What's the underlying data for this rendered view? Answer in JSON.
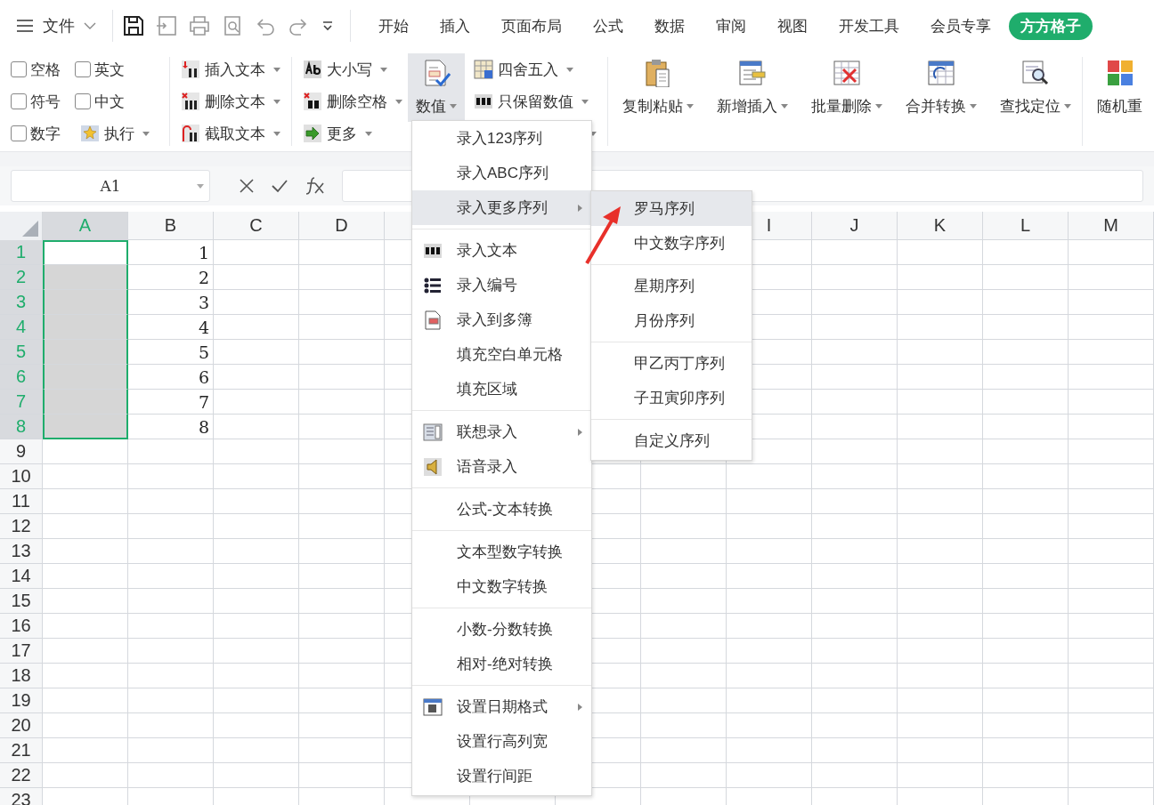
{
  "menu_bar": {
    "file_label": "文件"
  },
  "tabs": [
    {
      "label": "开始",
      "selected": false
    },
    {
      "label": "插入",
      "selected": false
    },
    {
      "label": "页面布局",
      "selected": false
    },
    {
      "label": "公式",
      "selected": false
    },
    {
      "label": "数据",
      "selected": false
    },
    {
      "label": "审阅",
      "selected": false
    },
    {
      "label": "视图",
      "selected": false
    },
    {
      "label": "开发工具",
      "selected": false
    },
    {
      "label": "会员专享",
      "selected": false
    },
    {
      "label": "方方格子",
      "selected": true
    }
  ],
  "ribbon": {
    "checkboxes": [
      {
        "label": "空格",
        "checked": false
      },
      {
        "label": "英文",
        "checked": false
      },
      {
        "label": "符号",
        "checked": false
      },
      {
        "label": "中文",
        "checked": false
      },
      {
        "label": "数字",
        "checked": false
      }
    ],
    "run_button": {
      "label": "执行"
    },
    "text_tools": [
      {
        "label": "插入文本"
      },
      {
        "label": "删除文本"
      },
      {
        "label": "截取文本"
      }
    ],
    "case_tools": [
      {
        "label": "大小写"
      },
      {
        "label": "删除空格"
      },
      {
        "label": "更多"
      }
    ],
    "value_button": {
      "label": "数值",
      "selected": true
    },
    "number_tools": [
      {
        "label": "四舍五入"
      },
      {
        "label": "只保留数值"
      }
    ],
    "big_buttons": [
      {
        "label": "复制粘贴"
      },
      {
        "label": "新增插入"
      },
      {
        "label": "批量删除"
      },
      {
        "label": "合并转换"
      },
      {
        "label": "查找定位"
      }
    ],
    "last_button": {
      "label": "随机重"
    }
  },
  "formula_bar": {
    "name_box": "A1"
  },
  "columns": [
    {
      "label": "A",
      "selected": true
    },
    {
      "label": "B",
      "selected": false
    },
    {
      "label": "C",
      "selected": false
    },
    {
      "label": "D",
      "selected": false
    },
    {
      "label": "I",
      "selected": false
    },
    {
      "label": "J",
      "selected": false
    },
    {
      "label": "K",
      "selected": false
    },
    {
      "label": "L",
      "selected": false
    },
    {
      "label": "M",
      "selected": false
    }
  ],
  "rows": [
    {
      "label": "1",
      "selected": true,
      "active": true,
      "cells": {
        "B": "1"
      }
    },
    {
      "label": "2",
      "selected": true,
      "active": false,
      "cells": {
        "B": "2"
      }
    },
    {
      "label": "3",
      "selected": true,
      "active": false,
      "cells": {
        "B": "3"
      }
    },
    {
      "label": "4",
      "selected": true,
      "active": false,
      "cells": {
        "B": "4"
      }
    },
    {
      "label": "5",
      "selected": true,
      "active": false,
      "cells": {
        "B": "5"
      }
    },
    {
      "label": "6",
      "selected": true,
      "active": false,
      "cells": {
        "B": "6"
      }
    },
    {
      "label": "7",
      "selected": true,
      "active": false,
      "cells": {
        "B": "7"
      }
    },
    {
      "label": "8",
      "selected": true,
      "active": false,
      "cells": {
        "B": "8"
      }
    },
    {
      "label": "9",
      "selected": false,
      "active": false
    },
    {
      "label": "10",
      "selected": false,
      "active": false
    },
    {
      "label": "11",
      "selected": false,
      "active": false
    },
    {
      "label": "12",
      "selected": false,
      "active": false
    },
    {
      "label": "13",
      "selected": false,
      "active": false
    },
    {
      "label": "14",
      "selected": false,
      "active": false
    },
    {
      "label": "15",
      "selected": false,
      "active": false
    },
    {
      "label": "16",
      "selected": false,
      "active": false
    },
    {
      "label": "17",
      "selected": false,
      "active": false
    },
    {
      "label": "18",
      "selected": false,
      "active": false
    },
    {
      "label": "19",
      "selected": false,
      "active": false
    },
    {
      "label": "20",
      "selected": false,
      "active": false
    },
    {
      "label": "21",
      "selected": false,
      "active": false
    },
    {
      "label": "22",
      "selected": false,
      "active": false
    },
    {
      "label": "23",
      "selected": false,
      "active": false
    }
  ],
  "dropdown_menu": {
    "groups": [
      {
        "items": [
          {
            "label": "录入123序列",
            "selected": false,
            "submenu": false
          },
          {
            "label": "录入ABC序列",
            "selected": false,
            "submenu": false
          },
          {
            "label": "录入更多序列",
            "selected": true,
            "submenu": true
          }
        ]
      },
      {
        "items": [
          {
            "label": "录入文本",
            "selected": false,
            "submenu": false,
            "kind": "abc"
          },
          {
            "label": "录入编号",
            "selected": false,
            "submenu": false,
            "kind": "list"
          },
          {
            "label": "录入到多簿",
            "selected": false,
            "submenu": false,
            "kind": "doc"
          },
          {
            "label": "填充空白单元格",
            "selected": false,
            "submenu": false
          },
          {
            "label": "填充区域",
            "selected": false,
            "submenu": false
          }
        ]
      },
      {
        "items": [
          {
            "label": "联想录入",
            "selected": false,
            "submenu": true,
            "kind": "panel"
          },
          {
            "label": "语音录入",
            "selected": false,
            "submenu": false,
            "kind": "speaker"
          }
        ]
      },
      {
        "items": [
          {
            "label": "公式-文本转换",
            "selected": false,
            "submenu": false
          }
        ]
      },
      {
        "items": [
          {
            "label": "文本型数字转换",
            "selected": false,
            "submenu": false
          },
          {
            "label": "中文数字转换",
            "selected": false,
            "submenu": false
          }
        ]
      },
      {
        "items": [
          {
            "label": "小数-分数转换",
            "selected": false,
            "submenu": false
          },
          {
            "label": "相对-绝对转换",
            "selected": false,
            "submenu": false
          }
        ]
      },
      {
        "items": [
          {
            "label": "设置日期格式",
            "selected": false,
            "submenu": true,
            "kind": "calendar"
          },
          {
            "label": "设置行高列宽",
            "selected": false,
            "submenu": false
          },
          {
            "label": "设置行间距",
            "selected": false,
            "submenu": false
          }
        ]
      }
    ]
  },
  "submenu": {
    "groups": [
      {
        "items": [
          {
            "label": "罗马序列",
            "selected": true
          },
          {
            "label": "中文数字序列",
            "selected": false
          }
        ]
      },
      {
        "items": [
          {
            "label": "星期序列",
            "selected": false
          },
          {
            "label": "月份序列",
            "selected": false
          }
        ]
      },
      {
        "items": [
          {
            "label": "甲乙丙丁序列",
            "selected": false
          },
          {
            "label": "子丑寅卯序列",
            "selected": false
          }
        ]
      },
      {
        "items": [
          {
            "label": "自定义序列",
            "selected": false
          }
        ]
      }
    ]
  }
}
